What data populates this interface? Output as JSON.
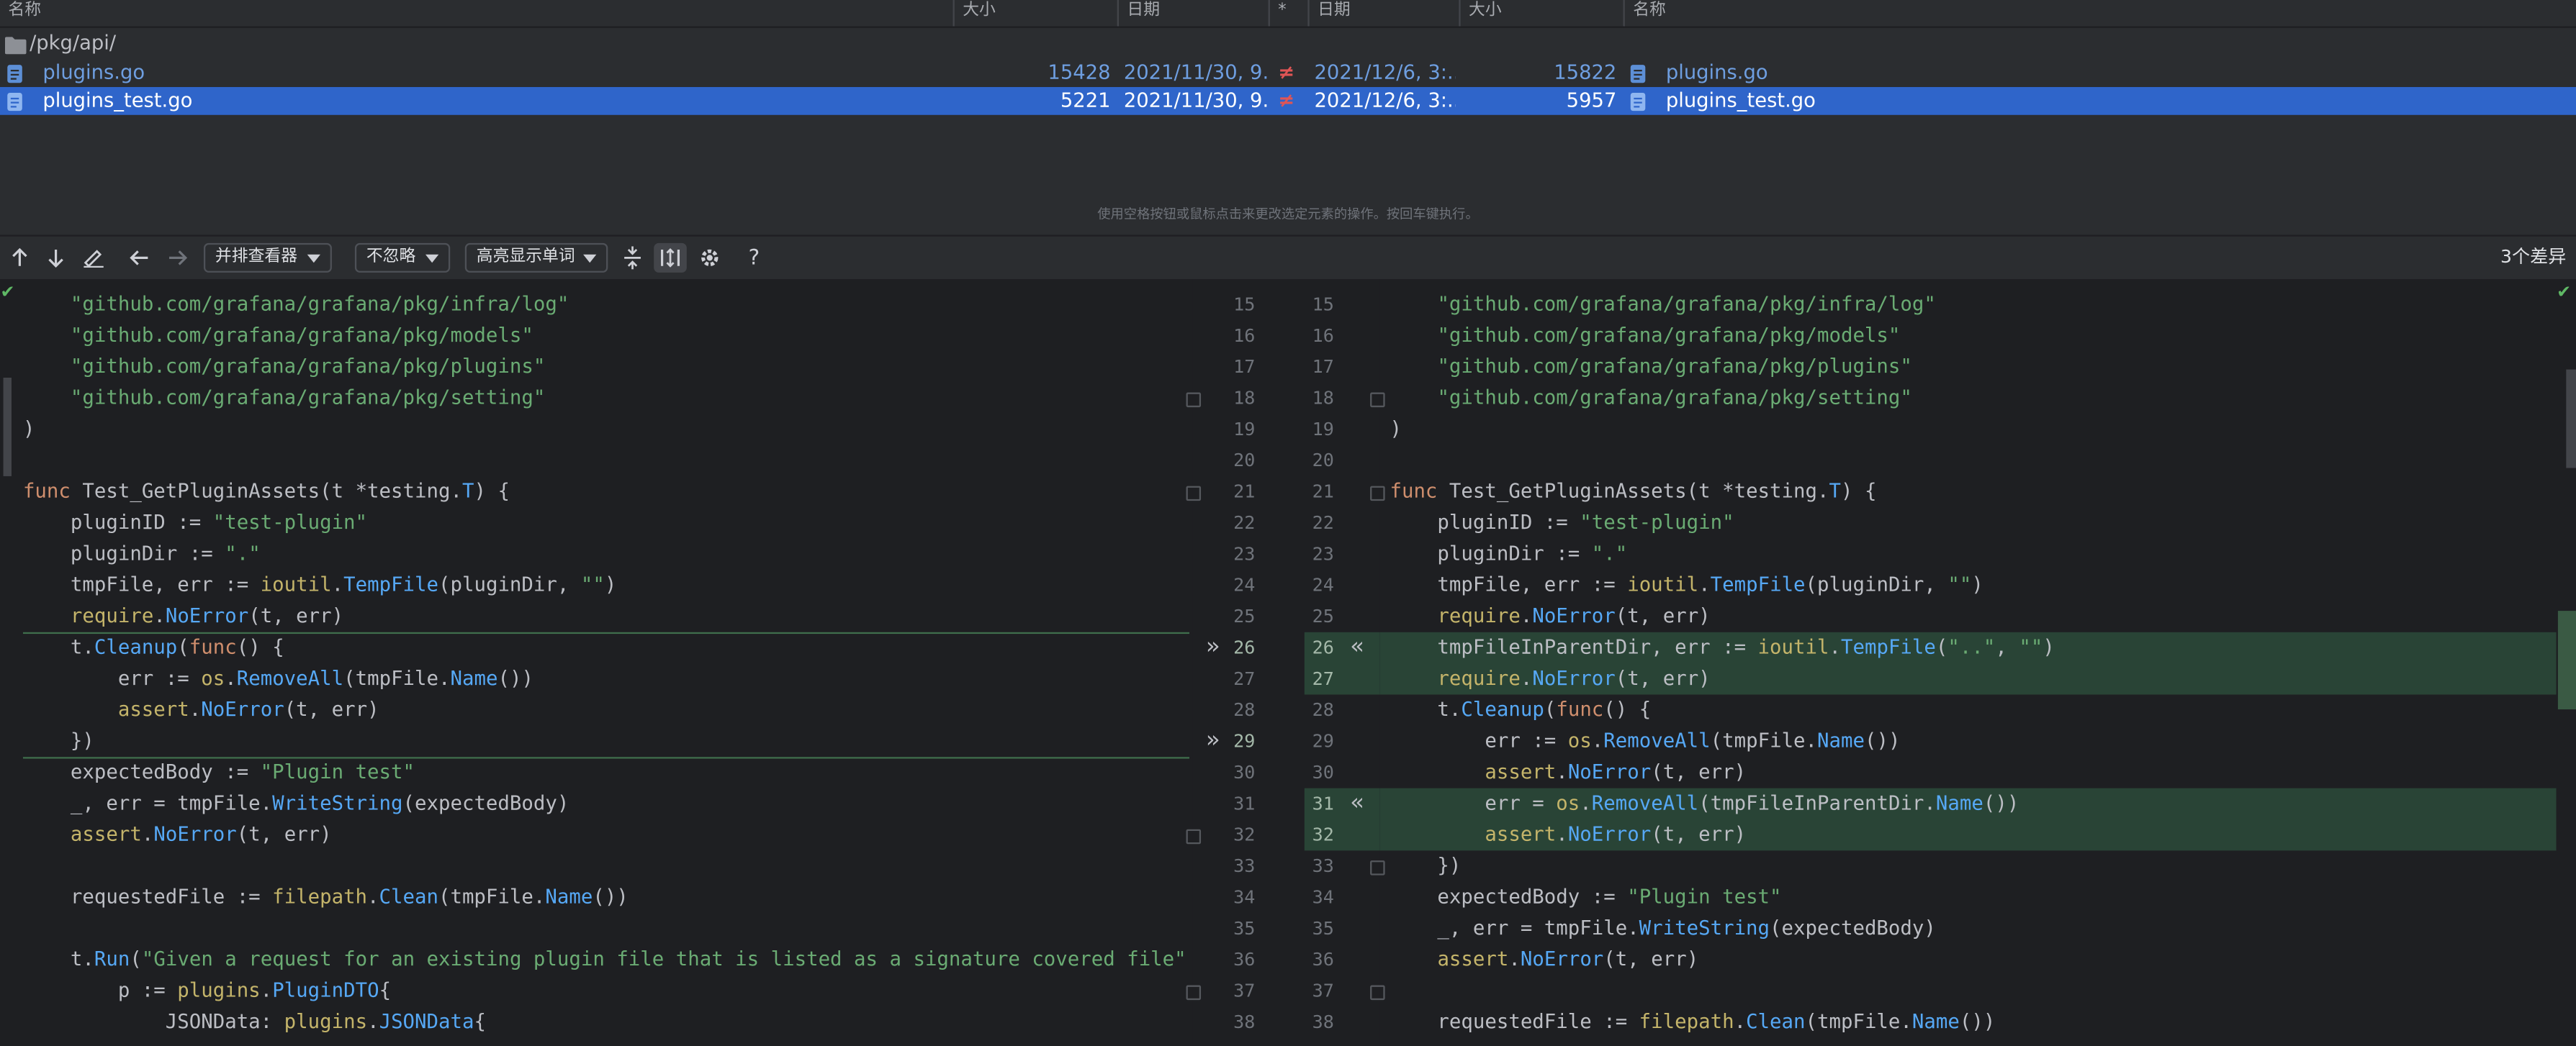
{
  "file_list": {
    "columns": {
      "name_left": "名称",
      "size_left": "大小",
      "date_left": "日期",
      "star": "*",
      "date_right": "日期",
      "size_right": "大小",
      "name_right": "名称"
    },
    "folder": "/pkg/api/",
    "files": [
      {
        "name_left": "plugins.go",
        "size_left": "15428",
        "date_left": "2021/11/30, 9...",
        "diff": "≠",
        "date_right": "2021/12/6, 3:...",
        "size_right": "15822",
        "name_right": "plugins.go"
      },
      {
        "name_left": "plugins_test.go",
        "size_left": "5221",
        "date_left": "2021/11/30, 9...",
        "diff": "≠",
        "date_right": "2021/12/6, 3:...",
        "size_right": "5957",
        "name_right": "plugins_test.go"
      }
    ],
    "status_hint": "使用空格按钮或鼠标点击来更改选定元素的操作。按回车键执行。"
  },
  "toolbar": {
    "viewer": "并排查看器",
    "ignore": "不忽略",
    "highlight": "高亮显示单词",
    "help": "?",
    "diff_count": "3个差异"
  },
  "diff": {
    "left_lines": [
      {
        "n": 15,
        "text": "    \"github.com/grafana/grafana/pkg/infra/log\""
      },
      {
        "n": 16,
        "text": "    \"github.com/grafana/grafana/pkg/models\""
      },
      {
        "n": 17,
        "text": "    \"github.com/grafana/grafana/pkg/plugins\""
      },
      {
        "n": 18,
        "text": "    \"github.com/grafana/grafana/pkg/setting\""
      },
      {
        "n": 19,
        "text": ")"
      },
      {
        "n": 20,
        "text": ""
      },
      {
        "n": 21,
        "text": "func Test_GetPluginAssets(t *testing.T) {"
      },
      {
        "n": 22,
        "text": "    pluginID := \"test-plugin\""
      },
      {
        "n": 23,
        "text": "    pluginDir := \".\""
      },
      {
        "n": 24,
        "text": "    tmpFile, err := ioutil.TempFile(pluginDir, \"\")"
      },
      {
        "n": 25,
        "text": "    require.NoError(t, err)"
      },
      {
        "n": 26,
        "text": "    t.Cleanup(func() {"
      },
      {
        "n": 27,
        "text": "        err := os.RemoveAll(tmpFile.Name())"
      },
      {
        "n": 28,
        "text": "        assert.NoError(t, err)"
      },
      {
        "n": 29,
        "text": "    })"
      },
      {
        "n": 30,
        "text": "    expectedBody := \"Plugin test\""
      },
      {
        "n": 31,
        "text": "    _, err = tmpFile.WriteString(expectedBody)"
      },
      {
        "n": 32,
        "text": "    assert.NoError(t, err)"
      },
      {
        "n": 33,
        "text": ""
      },
      {
        "n": 34,
        "text": "    requestedFile := filepath.Clean(tmpFile.Name())"
      },
      {
        "n": 35,
        "text": ""
      },
      {
        "n": 36,
        "text": "    t.Run(\"Given a request for an existing plugin file that is listed as a signature covered file\", f"
      },
      {
        "n": 37,
        "text": "        p := plugins.PluginDTO{"
      },
      {
        "n": 38,
        "text": "            JSONData: plugins.JSONData{"
      }
    ],
    "right_lines": [
      {
        "n": 15,
        "text": "    \"github.com/grafana/grafana/pkg/infra/log\""
      },
      {
        "n": 16,
        "text": "    \"github.com/grafana/grafana/pkg/models\""
      },
      {
        "n": 17,
        "text": "    \"github.com/grafana/grafana/pkg/plugins\""
      },
      {
        "n": 18,
        "text": "    \"github.com/grafana/grafana/pkg/setting\""
      },
      {
        "n": 19,
        "text": ")"
      },
      {
        "n": 20,
        "text": ""
      },
      {
        "n": 21,
        "text": "func Test_GetPluginAssets(t *testing.T) {"
      },
      {
        "n": 22,
        "text": "    pluginID := \"test-plugin\""
      },
      {
        "n": 23,
        "text": "    pluginDir := \".\""
      },
      {
        "n": 24,
        "text": "    tmpFile, err := ioutil.TempFile(pluginDir, \"\")"
      },
      {
        "n": 25,
        "text": "    require.NoError(t, err)"
      },
      {
        "n": 26,
        "text": "    tmpFileInParentDir, err := ioutil.TempFile(\"..\", \"\")"
      },
      {
        "n": 27,
        "text": "    require.NoError(t, err)"
      },
      {
        "n": 28,
        "text": "    t.Cleanup(func() {"
      },
      {
        "n": 29,
        "text": "        err := os.RemoveAll(tmpFile.Name())"
      },
      {
        "n": 30,
        "text": "        assert.NoError(t, err)"
      },
      {
        "n": 31,
        "text": "        err = os.RemoveAll(tmpFileInParentDir.Name())"
      },
      {
        "n": 32,
        "text": "        assert.NoError(t, err)"
      },
      {
        "n": 33,
        "text": "    })"
      },
      {
        "n": 34,
        "text": "    expectedBody := \"Plugin test\""
      },
      {
        "n": 35,
        "text": "    _, err = tmpFile.WriteString(expectedBody)"
      },
      {
        "n": 36,
        "text": "    assert.NoError(t, err)"
      },
      {
        "n": 37,
        "text": ""
      },
      {
        "n": 38,
        "text": "    requestedFile := filepath.Clean(tmpFile.Name())"
      }
    ]
  },
  "colors": {
    "background": "#1e1f22",
    "panel": "#2b2d30",
    "selection": "#2f65ca",
    "inserted": "#294436",
    "not_equal": "#e05555"
  },
  "icons": [
    "arrow-up-icon",
    "arrow-down-icon",
    "edit-icon",
    "back-icon",
    "forward-icon",
    "collapse-icon",
    "sync-scroll-icon",
    "settings-gear-icon",
    "help-icon",
    "folder-icon",
    "go-file-icon",
    "apply-change-icon",
    "check-icon"
  ]
}
